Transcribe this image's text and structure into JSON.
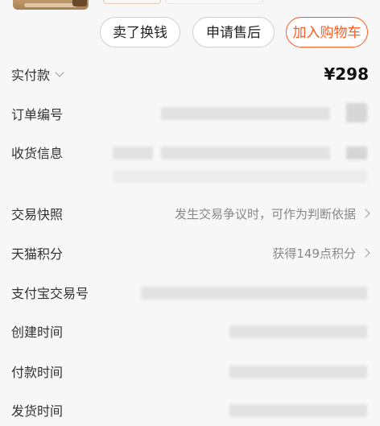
{
  "actions": {
    "sell": "卖了换钱",
    "after_sale": "申请售后",
    "add_cart": "加入购物车"
  },
  "details": {
    "paid": {
      "label": "实付款",
      "value": "¥298"
    },
    "order_no": {
      "label": "订单编号"
    },
    "shipping": {
      "label": "收货信息"
    },
    "snapshot": {
      "label": "交易快照",
      "value": "发生交易争议时，可作为判断依据"
    },
    "tmall_points": {
      "label": "天猫积分",
      "value": "获得149点积分"
    },
    "alipay_no": {
      "label": "支付宝交易号"
    },
    "created": {
      "label": "创建时间"
    },
    "paid_time": {
      "label": "付款时间"
    },
    "shipped_time": {
      "label": "发货时间"
    }
  },
  "icons": [
    "chevron-down-icon",
    "chevron-right-icon"
  ]
}
